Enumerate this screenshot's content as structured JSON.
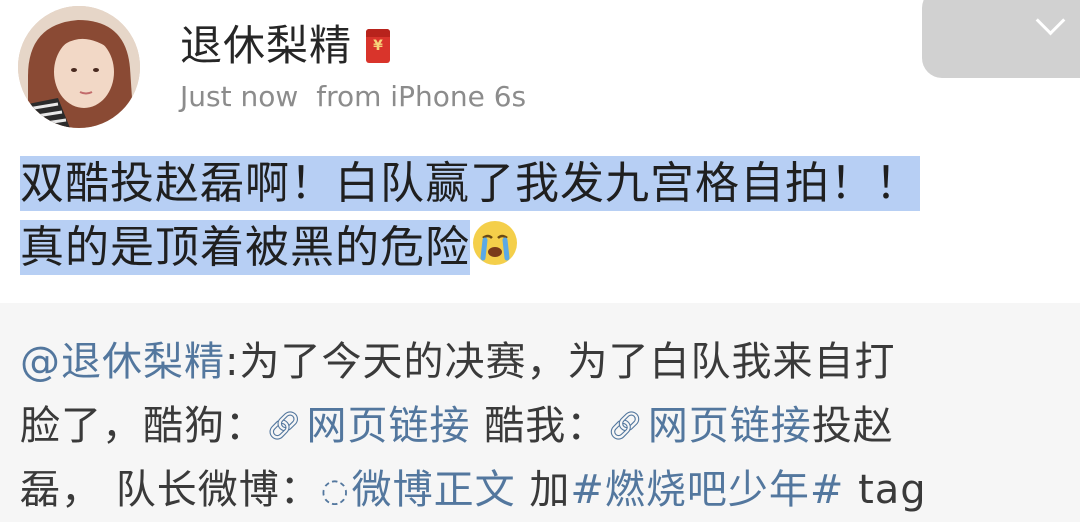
{
  "post": {
    "username": "退休梨精",
    "badge_icon": "red-envelope-icon",
    "time": "Just now",
    "source": "from iPhone 6s",
    "text_line1": "双酷投赵磊啊！白队赢了我发九宫格自拍！！",
    "text_line2": "真的是顶着被黑的危险",
    "emoji": "crying-face-icon"
  },
  "repost": {
    "mention": "@退休梨精",
    "line1_rest": ":为了今天的决赛，为了白队我来自打",
    "line2_a": "脸了，酷狗：",
    "link1": "网页链接",
    "line2_b": " 酷我：",
    "link2": "网页链接",
    "line2_c": "投赵",
    "line3_a": "磊， 队长微博：",
    "weibo_link": "微博正文",
    "line3_b": " 加",
    "topic": "#燃烧吧少年#",
    "line3_c": " tag"
  },
  "colors": {
    "highlight": "#b7cff4",
    "link": "#53779e",
    "meta": "#8c8c8c"
  }
}
